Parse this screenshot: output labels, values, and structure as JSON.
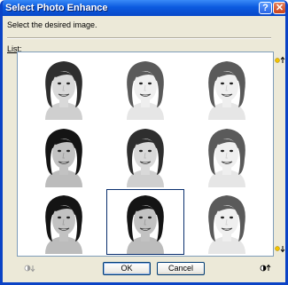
{
  "window": {
    "title": "Select Photo Enhance",
    "help_glyph": "?",
    "close_glyph": "✕"
  },
  "instruction": "Select the desired image.",
  "list_label": "List:",
  "thumbnails": [
    {
      "tone": "normal"
    },
    {
      "tone": "light"
    },
    {
      "tone": "light"
    },
    {
      "tone": "dark"
    },
    {
      "tone": "normal"
    },
    {
      "tone": "light"
    },
    {
      "tone": "dark"
    },
    {
      "tone": "dark",
      "selected": true
    },
    {
      "tone": "light"
    }
  ],
  "icons": {
    "brightness_up": "brightness-up-icon",
    "brightness_down": "brightness-down-icon",
    "contrast_down": "contrast-down-icon",
    "contrast_up": "contrast-up-icon"
  },
  "buttons": {
    "ok": "OK",
    "cancel": "Cancel"
  }
}
